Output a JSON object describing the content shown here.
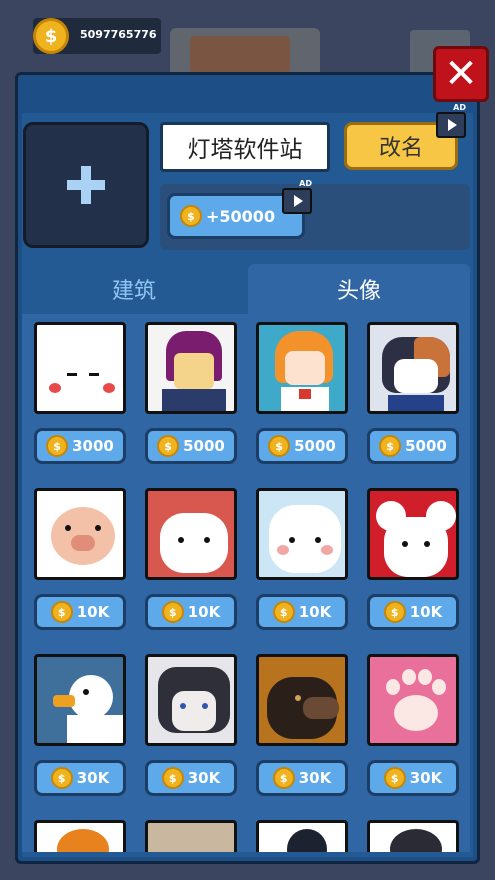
{
  "currency": {
    "icon": "coin-icon",
    "symbol": "$",
    "amount": "5097765776"
  },
  "profile": {
    "name_value": "灯塔软件站",
    "rename_label": "改名",
    "ad_label": "AD",
    "bonus_label": "+50000"
  },
  "tabs": [
    {
      "label": "建筑",
      "active": false
    },
    {
      "label": "头像",
      "active": true
    }
  ],
  "avatars": [
    {
      "name": "white-blob",
      "price": "3000"
    },
    {
      "name": "purple-hair-girl",
      "price": "5000"
    },
    {
      "name": "orange-hair-girl",
      "price": "5000"
    },
    {
      "name": "calico-cat-girl",
      "price": "5000"
    },
    {
      "name": "pig",
      "price": "10K"
    },
    {
      "name": "white-cat-red",
      "price": "10K"
    },
    {
      "name": "white-cat-blue",
      "price": "10K"
    },
    {
      "name": "mouse",
      "price": "10K"
    },
    {
      "name": "duck",
      "price": "30K"
    },
    {
      "name": "husky",
      "price": "30K"
    },
    {
      "name": "bear",
      "price": "30K"
    },
    {
      "name": "paw",
      "price": "30K"
    }
  ],
  "colors": {
    "panel": "#1d4f86",
    "tab_active": "#2f66a3",
    "price_button": "#5ea9ea",
    "rename_button": "#f7c645",
    "close_button": "#c0121a",
    "coin": "#f0b320"
  }
}
